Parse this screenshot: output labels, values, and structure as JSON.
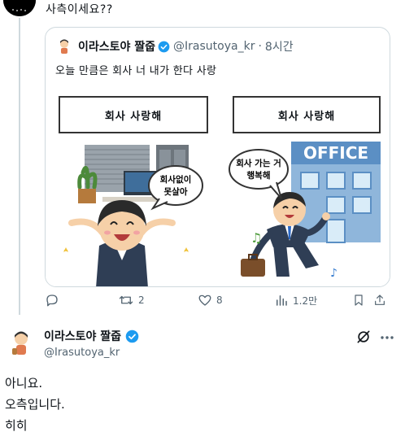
{
  "top_reply": {
    "text": "사측이세요??"
  },
  "quoted_post": {
    "author_name": "이라스토야 짤줍",
    "handle": "@Irasutoya_kr",
    "separator": "·",
    "time": "8시간",
    "text": "오늘 만큼은 회사 너 내가 한다 사랑",
    "image": {
      "left_panel_label": "회사 사랑해",
      "right_panel_label": "회사 사랑해",
      "left_bubble_line1": "회사없이",
      "left_bubble_line2": "못살아",
      "right_bubble_line1": "회사 가는 거",
      "right_bubble_line2": "행복해",
      "building_sign": "OFFICE"
    }
  },
  "actions": {
    "reply_count": "",
    "retweet_count": "2",
    "like_count": "8",
    "views_count": "1.2만"
  },
  "reply": {
    "author_name": "이라스토야 짤줍",
    "handle": "@Irasutoya_kr",
    "lines": [
      "아니요.",
      "오측입니다.",
      "히히"
    ]
  },
  "colors": {
    "verified": "#1d9bf0",
    "muted": "#536471",
    "border": "#cfd9de"
  }
}
